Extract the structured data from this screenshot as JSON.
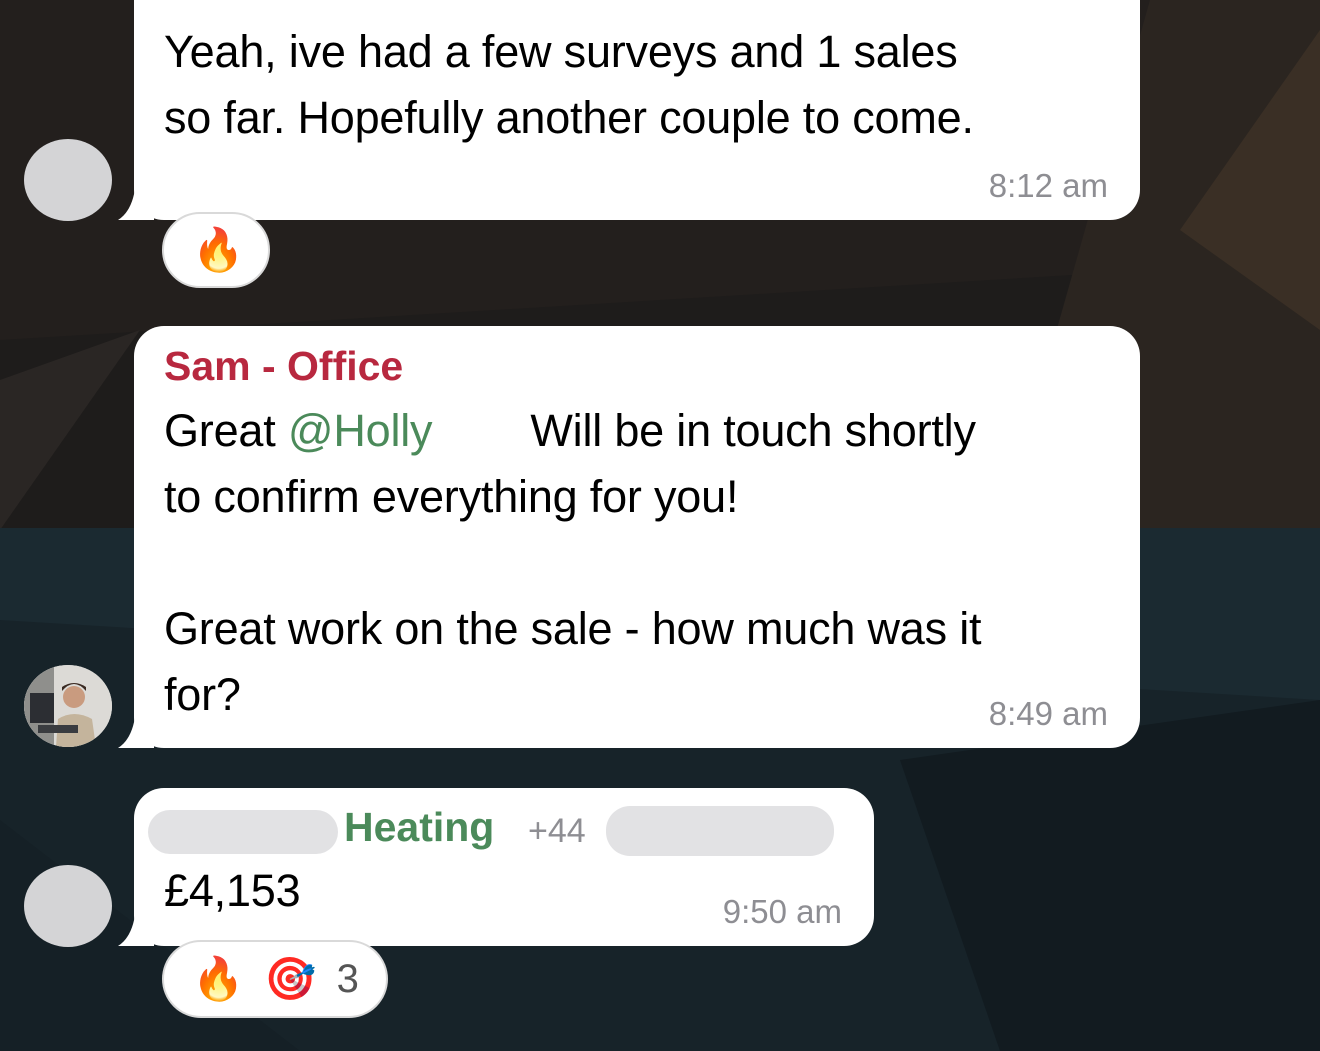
{
  "messages": [
    {
      "text_line1": "Yeah, ive had a few surveys and 1 sales",
      "text_line2": "so far. Hopefully another couple to come.",
      "time": "8:12 am",
      "reactions": [
        {
          "icon": "fire-icon",
          "glyph": "🔥"
        }
      ]
    },
    {
      "sender": "Sam - Office",
      "mention_prefix": "Great ",
      "mention": "@Holly",
      "line1_rest": "Will be in touch shortly",
      "line2": "to confirm everything for you!",
      "line3": "Great work on the sale - how much was it",
      "line4": "for?",
      "time": "8:49 am"
    },
    {
      "sender_visible": "Heating",
      "phone_prefix": "+44",
      "text": "£4,153",
      "time": "9:50 am",
      "reactions": [
        {
          "icon": "fire-icon",
          "glyph": "🔥"
        },
        {
          "icon": "target-icon",
          "glyph": "🎯"
        }
      ],
      "reaction_count": "3"
    }
  ],
  "colors": {
    "sender_sam": "#b8283f",
    "sender_heating": "#4b8a5a",
    "mention": "#4b8a5a",
    "time": "#8e8e93"
  }
}
